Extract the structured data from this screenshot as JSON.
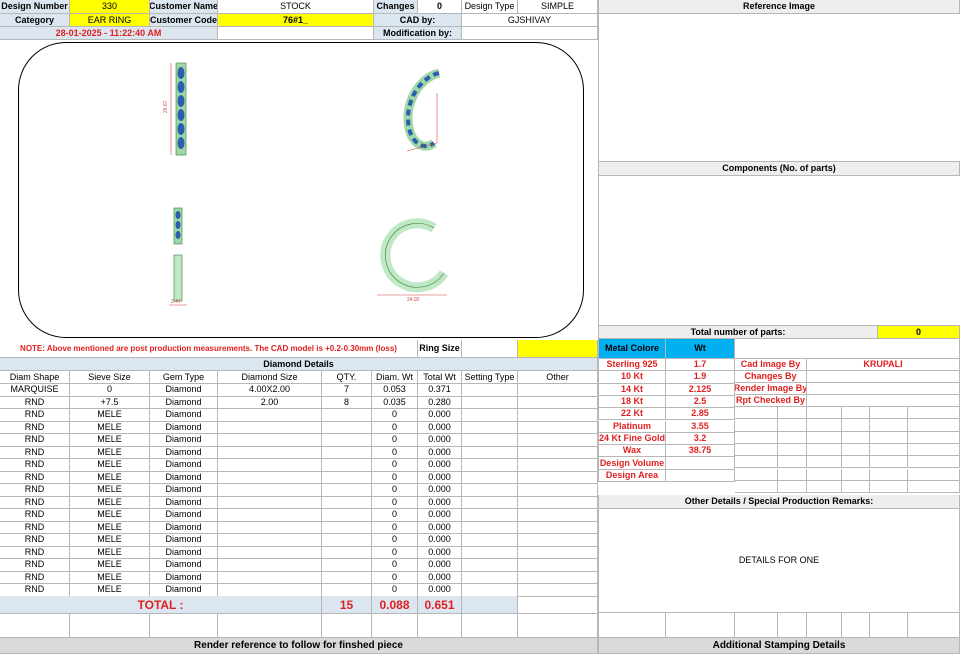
{
  "header": {
    "design_number_label": "Design Number",
    "design_number": "330",
    "customer_name_label": "Customer Name",
    "customer_name": "STOCK",
    "changes_label": "Changes",
    "changes": "0",
    "design_type_label": "Design Type",
    "design_type": "SIMPLE",
    "category_label": "Category",
    "category": "EAR RING",
    "customer_code_label": "Customer Code",
    "customer_code": "76#1_",
    "cad_by_label": "CAD by:",
    "cad_by": "GJSHIVAY",
    "datetime": "28-01-2025 - 11:22:40 AM",
    "modification_label": "Modification by:",
    "modification": ""
  },
  "reference": {
    "title": "Reference Image",
    "components_title": "Components (No. of parts)",
    "total_parts_label": "Total number of parts:",
    "total_parts": "0"
  },
  "drawing": {
    "dim_1": "26.67",
    "dim_2": "2.47",
    "dim_3": "24.92"
  },
  "note": "NOTE: Above mentioned are post production measurements. The CAD model is +0.2-0.30mm (loss)",
  "ring_size_label": "Ring Size",
  "ring_size": "",
  "diamond": {
    "title": "Diamond Details",
    "columns": [
      "Diam Shape",
      "Sieve Size",
      "Gem Type",
      "Diamond Size",
      "QTY.",
      "Diam. Wt",
      "Total Wt",
      "Setting Type",
      "Other"
    ],
    "rows": [
      [
        "MARQUISE",
        "0",
        "Diamond",
        "4.00X2.00",
        "7",
        "0.053",
        "0.371",
        "",
        ""
      ],
      [
        "RND",
        "+7.5",
        "Diamond",
        "2.00",
        "8",
        "0.035",
        "0.280",
        "",
        ""
      ],
      [
        "RND",
        "MELE",
        "Diamond",
        "",
        "",
        "0",
        "0.000",
        "",
        ""
      ],
      [
        "RND",
        "MELE",
        "Diamond",
        "",
        "",
        "0",
        "0.000",
        "",
        ""
      ],
      [
        "RND",
        "MELE",
        "Diamond",
        "",
        "",
        "0",
        "0.000",
        "",
        ""
      ],
      [
        "RND",
        "MELE",
        "Diamond",
        "",
        "",
        "0",
        "0.000",
        "",
        ""
      ],
      [
        "RND",
        "MELE",
        "Diamond",
        "",
        "",
        "0",
        "0.000",
        "",
        ""
      ],
      [
        "RND",
        "MELE",
        "Diamond",
        "",
        "",
        "0",
        "0.000",
        "",
        ""
      ],
      [
        "RND",
        "MELE",
        "Diamond",
        "",
        "",
        "0",
        "0.000",
        "",
        ""
      ],
      [
        "RND",
        "MELE",
        "Diamond",
        "",
        "",
        "0",
        "0.000",
        "",
        ""
      ],
      [
        "RND",
        "MELE",
        "Diamond",
        "",
        "",
        "0",
        "0.000",
        "",
        ""
      ],
      [
        "RND",
        "MELE",
        "Diamond",
        "",
        "",
        "0",
        "0.000",
        "",
        ""
      ],
      [
        "RND",
        "MELE",
        "Diamond",
        "",
        "",
        "0",
        "0.000",
        "",
        ""
      ],
      [
        "RND",
        "MELE",
        "Diamond",
        "",
        "",
        "0",
        "0.000",
        "",
        ""
      ],
      [
        "RND",
        "MELE",
        "Diamond",
        "",
        "",
        "0",
        "0.000",
        "",
        ""
      ],
      [
        "RND",
        "MELE",
        "Diamond",
        "",
        "",
        "0",
        "0.000",
        "",
        ""
      ],
      [
        "RND",
        "MELE",
        "Diamond",
        "",
        "",
        "0",
        "0.000",
        "",
        ""
      ]
    ],
    "total_label": "TOTAL :",
    "total_qty": "15",
    "total_diam_wt": "0.088",
    "total_wt": "0.651"
  },
  "metal": {
    "header_color": "Metal Colore",
    "header_wt": "Wt",
    "rows": [
      [
        "Sterling 925",
        "1.7"
      ],
      [
        "10 Kt",
        "1.9"
      ],
      [
        "14 Kt",
        "2.125"
      ],
      [
        "18 Kt",
        "2.5"
      ],
      [
        "22 Kt",
        "2.85"
      ],
      [
        "Platinum",
        "3.55"
      ],
      [
        "24 Kt Fine Gold",
        "3.2"
      ],
      [
        "Wax",
        "38.75"
      ],
      [
        "Design Volume",
        ""
      ],
      [
        "Design Area",
        ""
      ]
    ]
  },
  "cad_info": {
    "cad_image_by_label": "Cad Image By",
    "cad_image_by": "KRUPALI",
    "changes_by_label": "Changes By",
    "render_image_by_label": "Render Image By",
    "rpt_checked_by_label": "Rpt Checked By"
  },
  "other_details": {
    "title": "Other Details / Special Production Remarks:",
    "text": "DETAILS FOR ONE"
  },
  "footer": {
    "render_reference": "Render reference to follow for finshed piece",
    "additional_stamping": "Additional Stamping Details"
  },
  "colors": {
    "header_blue": "#dce6f1",
    "highlight_yellow": "#ffff00",
    "metal_blue": "#00b0f0",
    "label_red": "#e02020"
  }
}
